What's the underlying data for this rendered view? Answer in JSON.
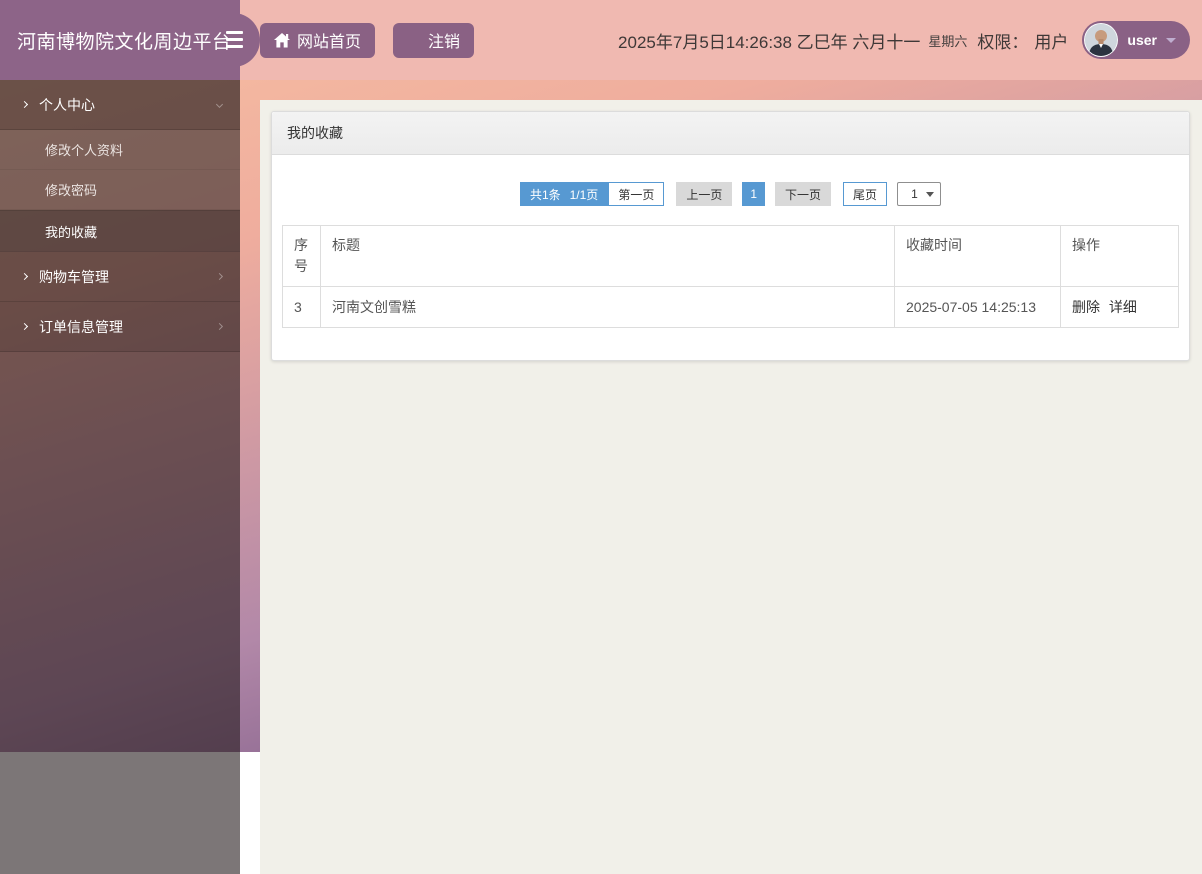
{
  "brand": {
    "title": "河南博物院文化周边平台"
  },
  "topbar": {
    "home_button": "网站首页",
    "logout_button": "注销",
    "datetime_text": "2025年7月5日14:26:38 乙巳年 六月十一",
    "weekday": "星期六",
    "permission_label": "权限：",
    "permission_value": "用户",
    "username": "user"
  },
  "sidebar": {
    "sections": [
      {
        "label": "个人中心",
        "expanded": true,
        "children": [
          {
            "label": "修改个人资料",
            "active": false
          },
          {
            "label": "修改密码",
            "active": false
          },
          {
            "label": "我的收藏",
            "active": true
          }
        ]
      },
      {
        "label": "购物车管理",
        "expanded": false,
        "children": []
      },
      {
        "label": "订单信息管理",
        "expanded": false,
        "children": []
      }
    ]
  },
  "panel": {
    "title": "我的收藏",
    "pagination": {
      "total": "共1条",
      "page_info": "1/1页",
      "first": "第一页",
      "prev": "上一页",
      "current": "1",
      "next": "下一页",
      "last": "尾页",
      "select_value": "1"
    },
    "table": {
      "headers": [
        "序号",
        "标题",
        "收藏时间",
        "操作"
      ],
      "row": {
        "no": "3",
        "title": "河南文创雪糕",
        "time": "2025-07-05 14:25:13",
        "action_delete": "删除",
        "action_detail": "详细"
      }
    }
  },
  "icons": {
    "hamburger": "hamburger-icon",
    "home": "home-icon",
    "logout": "menu-lines-icon",
    "user_caret": "caret-down-icon",
    "section_arrow": "chevron-right-icon"
  },
  "colors": {
    "topbar_pink": "#f0b9b1",
    "brand_purple": "#8d6488",
    "button_purple": "#8a6184",
    "accent_blue": "#5799d2",
    "content_beige": "#f1f0e9",
    "gradient_start": "#f8c1a2",
    "gradient_end": "#593d71",
    "gray_button": "#d9d9d9",
    "table_border": "#dddddd"
  }
}
